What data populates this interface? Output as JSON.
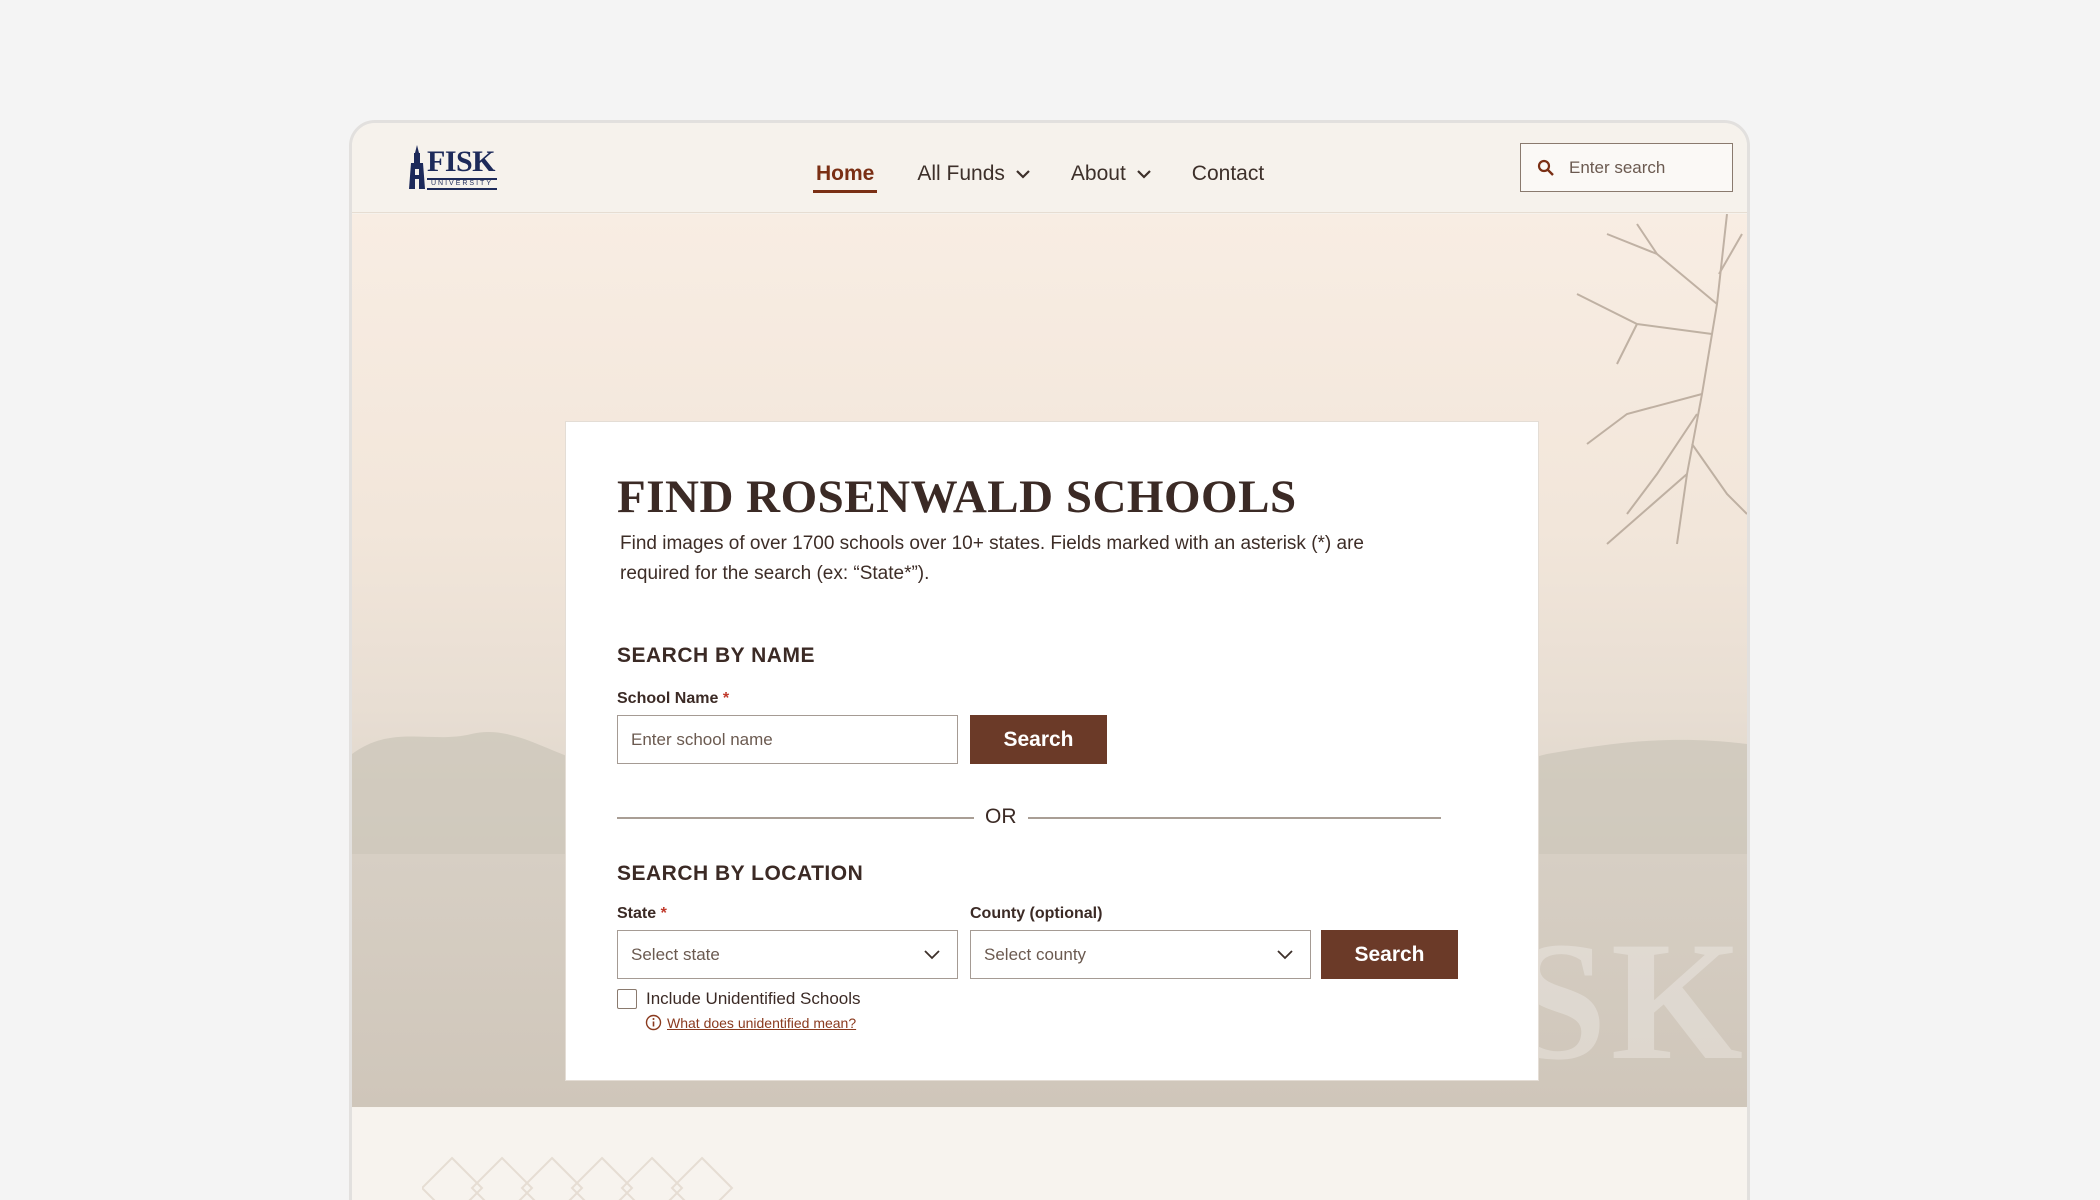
{
  "brand": {
    "logo_word": "FISK",
    "logo_sub": "UNIVERSITY"
  },
  "nav": {
    "items": [
      {
        "label": "Home",
        "active": true,
        "dropdown": false
      },
      {
        "label": "All Funds",
        "active": false,
        "dropdown": true
      },
      {
        "label": "About",
        "active": false,
        "dropdown": true
      },
      {
        "label": "Contact",
        "active": false,
        "dropdown": false
      }
    ],
    "search_placeholder": "Enter search"
  },
  "hero": {
    "watermark": "FISK"
  },
  "card": {
    "title": "FIND ROSENWALD SCHOOLS",
    "description": "Find images of over 1700 schools over 10+ states. Fields marked with an asterisk (*) are required for the search (ex: “State*”).",
    "by_name": {
      "section_title": "SEARCH BY NAME",
      "field_label": "School Name",
      "required_mark": "*",
      "placeholder": "Enter school name",
      "button": "Search"
    },
    "divider": "OR",
    "by_location": {
      "section_title": "SEARCH BY LOCATION",
      "state_label": "State",
      "required_mark": "*",
      "state_placeholder": "Select state",
      "county_label": "County (optional)",
      "county_placeholder": "Select county",
      "button": "Search",
      "checkbox_label": "Include Unidentified Schools",
      "checkbox_checked": false,
      "help_link": "What does unidentified mean?"
    }
  },
  "colors": {
    "accent": "#7a2f14",
    "button": "#6b3a28",
    "brand_navy": "#1d2a5a",
    "required": "#c0392b"
  }
}
